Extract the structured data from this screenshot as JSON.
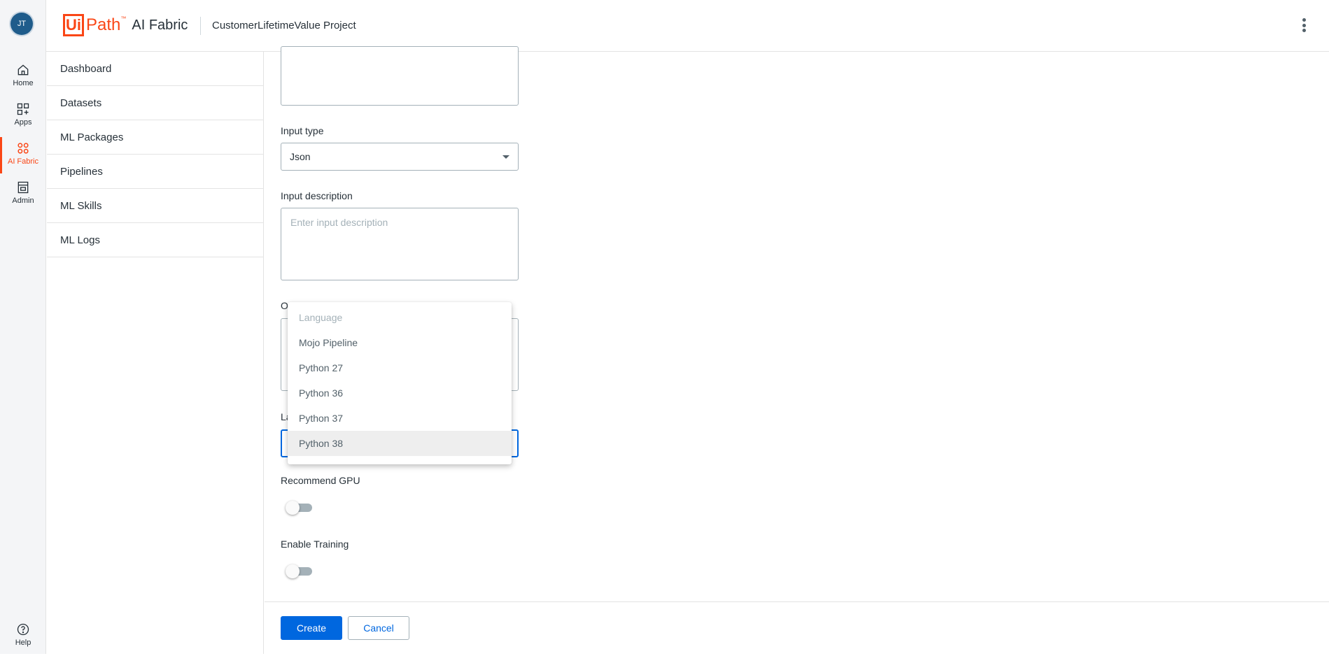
{
  "rail": {
    "avatar_initials": "JT",
    "items": [
      {
        "label": "Home",
        "icon": "home-icon"
      },
      {
        "label": "Apps",
        "icon": "apps-icon"
      },
      {
        "label": "AI Fabric",
        "icon": "ai-fabric-icon",
        "active": true
      },
      {
        "label": "Admin",
        "icon": "admin-icon"
      }
    ],
    "help_label": "Help"
  },
  "header": {
    "logo_ui": "Ui",
    "logo_path": "Path",
    "logo_tm": "™",
    "product": "AI Fabric",
    "project": "CustomerLifetimeValue Project"
  },
  "sidenav": {
    "items": [
      "Dashboard",
      "Datasets",
      "ML Packages",
      "Pipelines",
      "ML Skills",
      "ML Logs"
    ]
  },
  "form": {
    "input_type_label": "Input type",
    "input_type_value": "Json",
    "input_description_label": "Input description",
    "input_description_placeholder": "Enter input description",
    "output_label_partial": "O",
    "language_label_partial": "La",
    "recommend_gpu_label": "Recommend GPU",
    "enable_training_label": "Enable Training"
  },
  "language_menu": {
    "placeholder": "Language",
    "options": [
      "Mojo Pipeline",
      "Python 27",
      "Python 36",
      "Python 37",
      "Python 38"
    ],
    "selected": "Python 38"
  },
  "footer": {
    "create_label": "Create",
    "cancel_label": "Cancel"
  },
  "colors": {
    "brand": "#fa4616",
    "primary": "#0067df"
  }
}
